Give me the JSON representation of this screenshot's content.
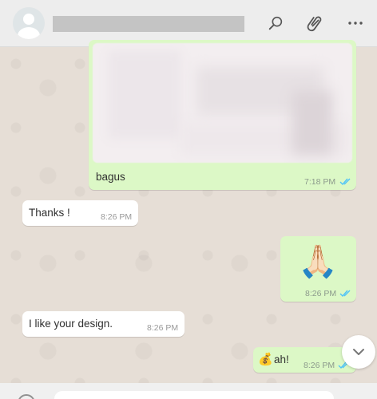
{
  "header": {
    "search_icon": "search-icon",
    "attach_icon": "paperclip-icon",
    "menu_icon": "more-options-icon"
  },
  "messages": [
    {
      "direction": "outgoing",
      "type": "image",
      "caption": "bagus",
      "time": "7:18 PM",
      "status": "read"
    },
    {
      "direction": "incoming",
      "type": "text",
      "text": "Thanks !",
      "time": "8:26 PM"
    },
    {
      "direction": "outgoing",
      "type": "emoji",
      "emoji": "🙏🏻",
      "time": "8:26 PM",
      "status": "read"
    },
    {
      "direction": "incoming",
      "type": "text",
      "text": "I like your design.",
      "time": "8:26 PM"
    },
    {
      "direction": "outgoing",
      "type": "text",
      "emoji": "💰",
      "text": "ah!",
      "time": "8:26 PM",
      "status": "read"
    }
  ],
  "colors": {
    "outgoing_bubble": "#dcf8c6",
    "incoming_bubble": "#ffffff",
    "read_ticks": "#4fc3f7",
    "header_bg": "#ededed",
    "chat_bg": "#e6ded6"
  }
}
